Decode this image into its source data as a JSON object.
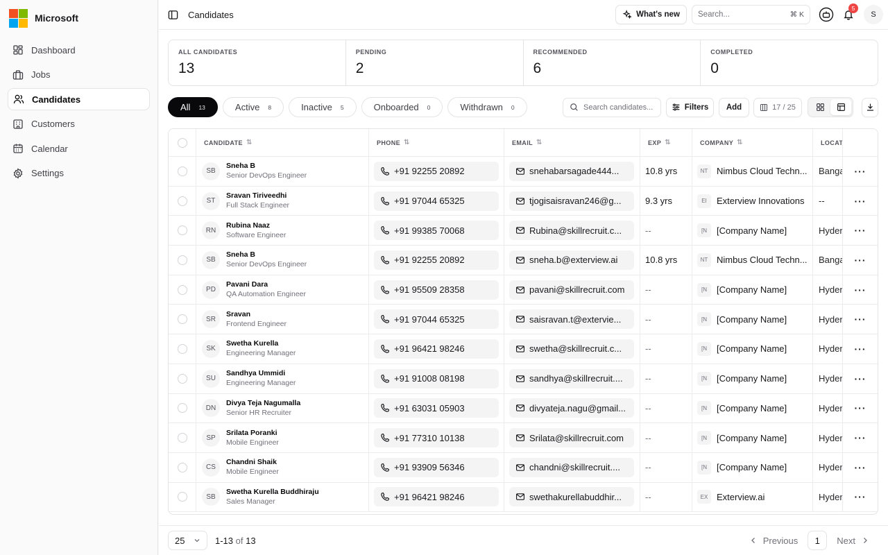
{
  "brand": {
    "name": "Microsoft",
    "logo_colors": [
      "#f25022",
      "#7fba00",
      "#00a4ef",
      "#ffb900"
    ]
  },
  "nav": [
    {
      "label": "Dashboard",
      "icon": "dashboard-icon"
    },
    {
      "label": "Jobs",
      "icon": "briefcase-icon"
    },
    {
      "label": "Candidates",
      "icon": "users-icon",
      "active": true
    },
    {
      "label": "Customers",
      "icon": "building-icon"
    },
    {
      "label": "Calendar",
      "icon": "calendar-icon"
    },
    {
      "label": "Settings",
      "icon": "gear-icon"
    }
  ],
  "header": {
    "title": "Candidates",
    "whats_new": "What's new",
    "search_placeholder": "Search...",
    "search_shortcut": "⌘ K",
    "notifications_count": "5",
    "user_initial": "S"
  },
  "stats": [
    {
      "label": "ALL CANDIDATES",
      "value": "13"
    },
    {
      "label": "PENDING",
      "value": "2"
    },
    {
      "label": "RECOMMENDED",
      "value": "6"
    },
    {
      "label": "COMPLETED",
      "value": "0"
    }
  ],
  "filters": {
    "chips": [
      {
        "label": "All",
        "count": "13",
        "active": true
      },
      {
        "label": "Active",
        "count": "8"
      },
      {
        "label": "Inactive",
        "count": "5"
      },
      {
        "label": "Onboarded",
        "count": "0"
      },
      {
        "label": "Withdrawn",
        "count": "0"
      }
    ],
    "search_placeholder": "Search candidates...",
    "filters_label": "Filters",
    "add_label": "Add",
    "columns_label": "17 / 25"
  },
  "table": {
    "columns": [
      "CANDIDATE",
      "PHONE",
      "EMAIL",
      "EXP",
      "COMPANY",
      "LOCAT"
    ],
    "rows": [
      {
        "initials": "SB",
        "name": "Sneha B",
        "role": "Senior DevOps Engineer",
        "phone": "+91 92255 20892",
        "email": "snehabarsagade444...",
        "exp": "10.8 yrs",
        "company_icon": "NT",
        "company": "Nimbus Cloud Techn...",
        "location": "Banga"
      },
      {
        "initials": "ST",
        "name": "Sravan Tiriveedhi",
        "role": "Full Stack Engineer",
        "phone": "+91 97044 65325",
        "email": "tjogisaisravan246@g...",
        "exp": "9.3 yrs",
        "company_icon": "EI",
        "company": "Exterview Innovations",
        "location": "--"
      },
      {
        "initials": "RN",
        "name": "Rubina Naaz",
        "role": "Software Engineer",
        "phone": "+91 99385 70068",
        "email": "Rubina@skillrecruit.c...",
        "exp": "--",
        "company_icon": "[N",
        "company": "[Company Name]",
        "location": "Hyder"
      },
      {
        "initials": "SB",
        "name": "Sneha B",
        "role": "Senior DevOps Engineer",
        "phone": "+91 92255 20892",
        "email": "sneha.b@exterview.ai",
        "exp": "10.8 yrs",
        "company_icon": "NT",
        "company": "Nimbus Cloud Techn...",
        "location": "Banga"
      },
      {
        "initials": "PD",
        "name": "Pavani Dara",
        "role": "QA Automation Engineer",
        "phone": "+91 95509 28358",
        "email": "pavani@skillrecruit.com",
        "exp": "--",
        "company_icon": "[N",
        "company": "[Company Name]",
        "location": "Hyder"
      },
      {
        "initials": "SR",
        "name": "Sravan",
        "role": "Frontend Engineer",
        "phone": "+91 97044 65325",
        "email": "saisravan.t@extervie...",
        "exp": "--",
        "company_icon": "[N",
        "company": "[Company Name]",
        "location": "Hyder"
      },
      {
        "initials": "SK",
        "name": "Swetha Kurella",
        "role": "Engineering Manager",
        "phone": "+91 96421 98246",
        "email": "swetha@skillrecruit.c...",
        "exp": "--",
        "company_icon": "[N",
        "company": "[Company Name]",
        "location": "Hyder"
      },
      {
        "initials": "SU",
        "name": "Sandhya Ummidi",
        "role": "Engineering Manager",
        "phone": "+91 91008 08198",
        "email": "sandhya@skillrecruit....",
        "exp": "--",
        "company_icon": "[N",
        "company": "[Company Name]",
        "location": "Hyder"
      },
      {
        "initials": "DN",
        "name": "Divya Teja Nagumalla",
        "role": "Senior HR Recruiter",
        "phone": "+91 63031 05903",
        "email": "divyateja.nagu@gmail...",
        "exp": "--",
        "company_icon": "[N",
        "company": "[Company Name]",
        "location": "Hyder"
      },
      {
        "initials": "SP",
        "name": "Srilata Poranki",
        "role": "Mobile Engineer",
        "phone": "+91 77310 10138",
        "email": "Srilata@skillrecruit.com",
        "exp": "--",
        "company_icon": "[N",
        "company": "[Company Name]",
        "location": "Hyder"
      },
      {
        "initials": "CS",
        "name": "Chandni Shaik",
        "role": "Mobile Engineer",
        "phone": "+91 93909 56346",
        "email": "chandni@skillrecruit....",
        "exp": "--",
        "company_icon": "[N",
        "company": "[Company Name]",
        "location": "Hyder"
      },
      {
        "initials": "SB",
        "name": "Swetha Kurella Buddhiraju",
        "role": "Sales Manager",
        "phone": "+91 96421 98246",
        "email": "swethakurellabuddhir...",
        "exp": "--",
        "company_icon": "EX",
        "company": "Exterview.ai",
        "location": "Hyder"
      }
    ]
  },
  "pagination": {
    "page_size": "25",
    "range": "1-13",
    "of_label": "of",
    "total": "13",
    "previous": "Previous",
    "page": "1",
    "next": "Next"
  }
}
